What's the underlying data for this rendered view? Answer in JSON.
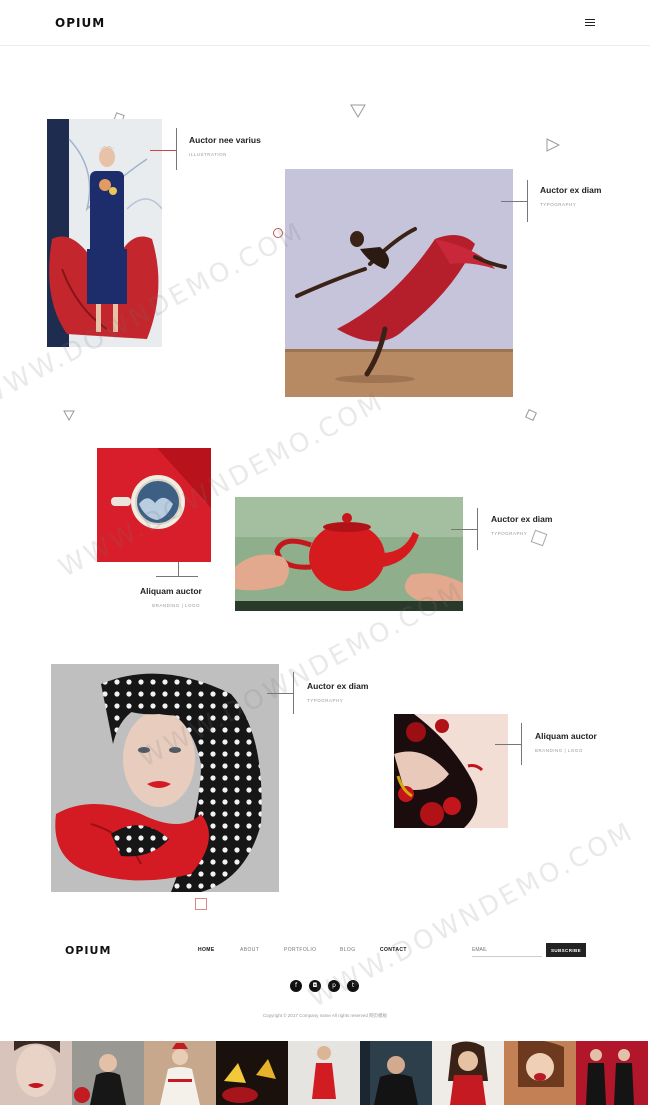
{
  "header": {
    "logo": "OPIUM",
    "menu_icon": "hamburger-icon"
  },
  "portfolio": {
    "items": [
      {
        "title": "Auctor nee varius",
        "category": "ILLUSTRATION"
      },
      {
        "title": "Auctor ex diam",
        "category": "TYPOGRAPHY"
      },
      {
        "title": "Aliquam auctor",
        "category": "BRANDING | LOGO"
      },
      {
        "title": "Auctor ex diam",
        "category": "TYPOGRAPHY"
      },
      {
        "title": "Auctor ex diam",
        "category": "TYPOGRAPHY"
      },
      {
        "title": "Aliquam auctor",
        "category": "BRANDING | LOGO"
      }
    ]
  },
  "footer": {
    "logo": "OPIUM",
    "nav": [
      "HOME",
      "ABOUT",
      "PORTFOLIO",
      "BLOG",
      "CONTACT"
    ],
    "email_placeholder": "EMAIL",
    "subscribe_label": "SUBSCRIBE",
    "social": [
      {
        "icon": "facebook-icon",
        "glyph": "f"
      },
      {
        "icon": "instagram-icon",
        "glyph": "◘"
      },
      {
        "icon": "pinterest-icon",
        "glyph": "p"
      },
      {
        "icon": "twitter-icon",
        "glyph": "t"
      }
    ],
    "copyright": "Copyright © 2017 Company name All rights reserved 网页模板"
  },
  "watermark": "WWW.DOWNDEMO.COM",
  "colors": {
    "accent_red": "#d61f26",
    "text_dark": "#222222",
    "text_muted": "#999999"
  }
}
